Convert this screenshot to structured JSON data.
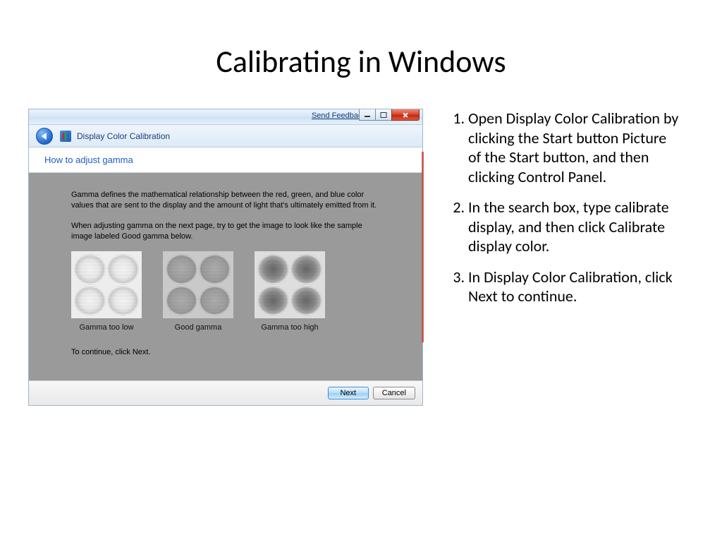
{
  "slide": {
    "title": "Calibrating in Windows"
  },
  "window": {
    "send_feedback": "Send Feedback",
    "app_title": "Display Color Calibration",
    "heading": "How to adjust gamma",
    "para1": "Gamma defines the mathematical relationship between the red, green, and blue color values that are sent to the display and the amount of light that's ultimately emitted from it.",
    "para2": "When adjusting gamma on the next page, try to get the image to look like the sample image labeled Good gamma below.",
    "samples": {
      "low": "Gamma too low",
      "good": "Good gamma",
      "high": "Gamma too high"
    },
    "continue": "To continue, click Next.",
    "buttons": {
      "next": "Next",
      "cancel": "Cancel"
    }
  },
  "steps": [
    "Open Display Color Calibration by clicking the Start button Picture of the Start button, and then clicking Control Panel.",
    "In the search box, type calibrate display, and then click Calibrate display color.",
    "In Display Color Calibration, click Next to continue."
  ]
}
